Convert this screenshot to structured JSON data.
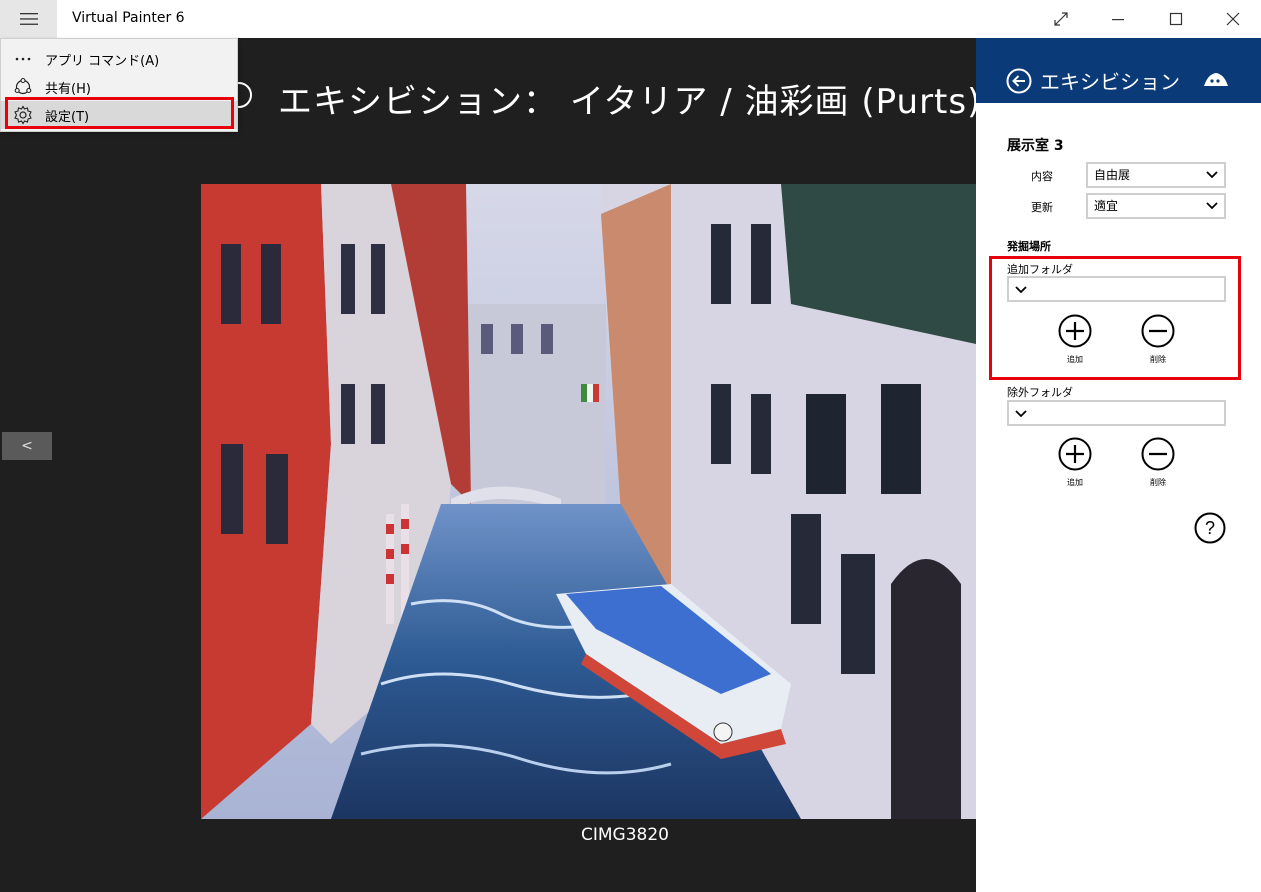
{
  "titlebar": {
    "app_title": "Virtual Painter 6"
  },
  "menu": {
    "items": [
      {
        "label": "アプリ コマンド(A)",
        "icon": "more-icon"
      },
      {
        "label": "共有(H)",
        "icon": "share-icon"
      },
      {
        "label": "設定(T)",
        "icon": "gear-icon",
        "selected": true
      }
    ]
  },
  "gallery": {
    "title_label": "エキシビション：",
    "title_value": "イタリア / 油彩画 ",
    "title_style": "(Purts)",
    "prev_label": "<",
    "caption": "CIMG3820"
  },
  "pane": {
    "title": "エキシビション",
    "room_title": "展示室 3",
    "content_label": "内容",
    "content_value": "自由展",
    "update_label": "更新",
    "update_value": "適宜",
    "source_label": "発掘場所",
    "add_folder_label": "追加フォルダ",
    "exclude_folder_label": "除外フォルダ",
    "add_button_label": "追加",
    "remove_button_label": "削除",
    "help_label": "?"
  },
  "colors": {
    "accent_header": "#0b3a78",
    "highlight": "#e8000b",
    "gallery_bg": "#1f1f1f"
  }
}
